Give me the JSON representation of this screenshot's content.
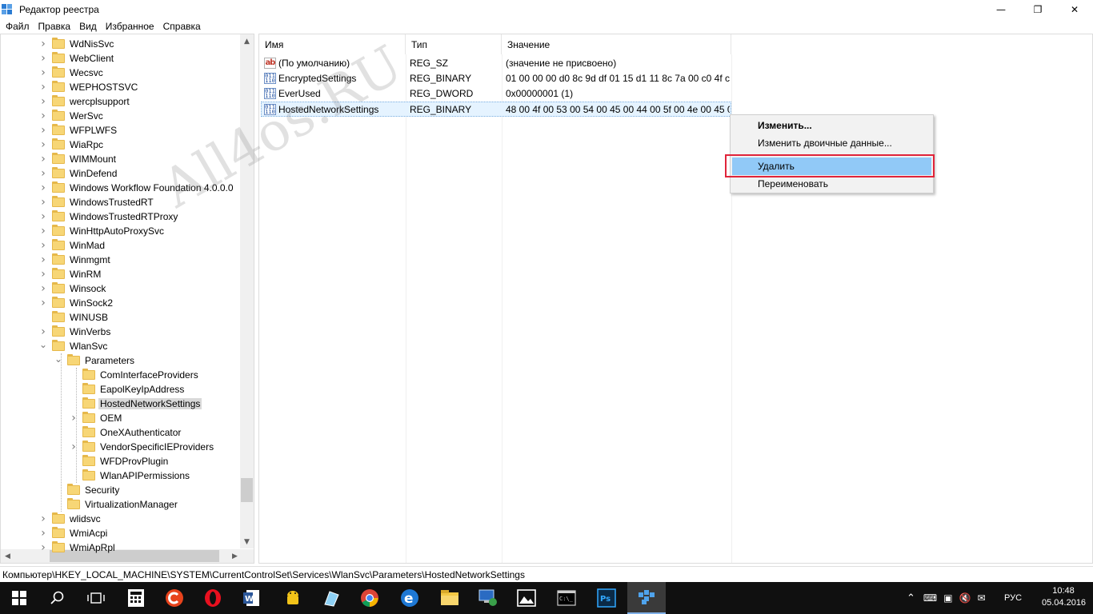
{
  "window": {
    "title": "Редактор реестра",
    "minimize_glyph": "—",
    "restore_glyph": "❐",
    "close_glyph": "✕"
  },
  "menu": [
    "Файл",
    "Правка",
    "Вид",
    "Избранное",
    "Справка"
  ],
  "tree": {
    "items": [
      {
        "label": "WdNisSvc",
        "level": 0,
        "expander": "collapsed"
      },
      {
        "label": "WebClient",
        "level": 0,
        "expander": "collapsed"
      },
      {
        "label": "Wecsvc",
        "level": 0,
        "expander": "collapsed"
      },
      {
        "label": "WEPHOSTSVC",
        "level": 0,
        "expander": "collapsed"
      },
      {
        "label": "wercplsupport",
        "level": 0,
        "expander": "collapsed"
      },
      {
        "label": "WerSvc",
        "level": 0,
        "expander": "collapsed"
      },
      {
        "label": "WFPLWFS",
        "level": 0,
        "expander": "collapsed"
      },
      {
        "label": "WiaRpc",
        "level": 0,
        "expander": "collapsed"
      },
      {
        "label": "WIMMount",
        "level": 0,
        "expander": "collapsed"
      },
      {
        "label": "WinDefend",
        "level": 0,
        "expander": "collapsed"
      },
      {
        "label": "Windows Workflow Foundation 4.0.0.0",
        "level": 0,
        "expander": "collapsed"
      },
      {
        "label": "WindowsTrustedRT",
        "level": 0,
        "expander": "collapsed"
      },
      {
        "label": "WindowsTrustedRTProxy",
        "level": 0,
        "expander": "collapsed"
      },
      {
        "label": "WinHttpAutoProxySvc",
        "level": 0,
        "expander": "collapsed"
      },
      {
        "label": "WinMad",
        "level": 0,
        "expander": "collapsed"
      },
      {
        "label": "Winmgmt",
        "level": 0,
        "expander": "collapsed"
      },
      {
        "label": "WinRM",
        "level": 0,
        "expander": "collapsed"
      },
      {
        "label": "Winsock",
        "level": 0,
        "expander": "collapsed"
      },
      {
        "label": "WinSock2",
        "level": 0,
        "expander": "collapsed"
      },
      {
        "label": "WINUSB",
        "level": 0,
        "expander": "none"
      },
      {
        "label": "WinVerbs",
        "level": 0,
        "expander": "collapsed"
      },
      {
        "label": "WlanSvc",
        "level": 0,
        "expander": "expanded"
      },
      {
        "label": "Parameters",
        "level": 1,
        "expander": "expanded"
      },
      {
        "label": "ComInterfaceProviders",
        "level": 2,
        "expander": "none"
      },
      {
        "label": "EapolKeyIpAddress",
        "level": 2,
        "expander": "none"
      },
      {
        "label": "HostedNetworkSettings",
        "level": 2,
        "expander": "none",
        "selected": true
      },
      {
        "label": "OEM",
        "level": 2,
        "expander": "collapsed"
      },
      {
        "label": "OneXAuthenticator",
        "level": 2,
        "expander": "none"
      },
      {
        "label": "VendorSpecificIEProviders",
        "level": 2,
        "expander": "collapsed"
      },
      {
        "label": "WFDProvPlugin",
        "level": 2,
        "expander": "none"
      },
      {
        "label": "WlanAPIPermissions",
        "level": 2,
        "expander": "none"
      },
      {
        "label": "Security",
        "level": 1,
        "expander": "none"
      },
      {
        "label": "VirtualizationManager",
        "level": 1,
        "expander": "none"
      },
      {
        "label": "wlidsvc",
        "level": 0,
        "expander": "collapsed"
      },
      {
        "label": "WmiAcpi",
        "level": 0,
        "expander": "collapsed"
      },
      {
        "label": "WmiApRpl",
        "level": 0,
        "expander": "collapsed"
      }
    ]
  },
  "columns": {
    "name": "Имя",
    "type": "Тип",
    "value": "Значение"
  },
  "values": [
    {
      "icon": "string",
      "name": "(По умолчанию)",
      "type": "REG_SZ",
      "data": "(значение не присвоено)"
    },
    {
      "icon": "binary",
      "name": "EncryptedSettings",
      "type": "REG_BINARY",
      "data": "01 00 00 00 d0 8c 9d df 01 15 d1 11 8c 7a 00 c0 4f c..."
    },
    {
      "icon": "binary",
      "name": "EverUsed",
      "type": "REG_DWORD",
      "data": "0x00000001 (1)"
    },
    {
      "icon": "binary",
      "name": "HostedNetworkSettings",
      "type": "REG_BINARY",
      "data": "48 00 4f 00 53 00 54 00 45 00 44 00 5f 00 4e 00 45 00...",
      "selected": true
    }
  ],
  "context_menu": {
    "modify": "Изменить...",
    "modify_binary": "Изменить двоичные данные...",
    "delete": "Удалить",
    "rename": "Переименовать"
  },
  "watermark": "All4os.RU",
  "status_path": "Компьютер\\HKEY_LOCAL_MACHINE\\SYSTEM\\CurrentControlSet\\Services\\WlanSvc\\Parameters\\HostedNetworkSettings",
  "taskbar": {
    "language": "РУС",
    "time": "10:48",
    "date": "05.04.2016",
    "apps": [
      "calculator-icon",
      "ccleaner-icon",
      "opera-icon",
      "word-icon",
      "android-icon",
      "notepad-icon",
      "chrome-icon",
      "edge-icon",
      "explorer-icon",
      "remote-desktop-icon",
      "photos-icon",
      "cmd-icon",
      "photoshop-icon",
      "regedit-icon"
    ]
  },
  "colors": {
    "selection": "#e5f3ff",
    "menu_highlight": "#91c9f7",
    "highlight_frame": "#e0243a",
    "taskbar": "#101010",
    "folder": "#f7d676"
  }
}
